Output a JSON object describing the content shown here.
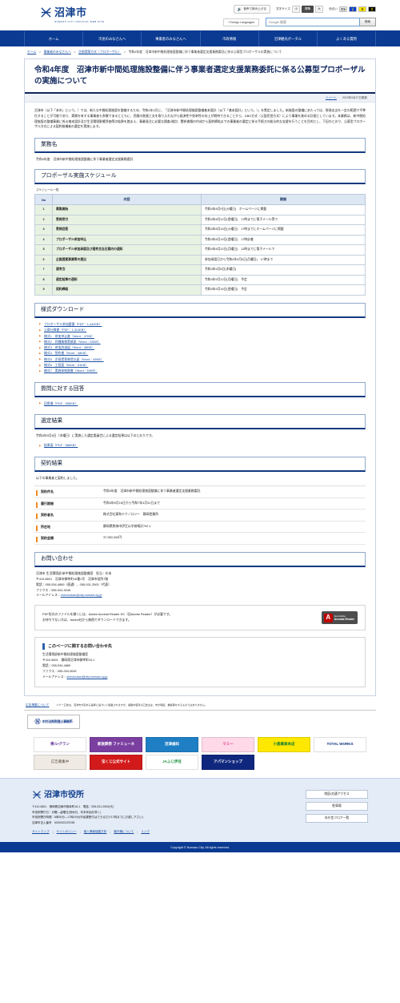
{
  "header": {
    "logo_mark": "logo-mark-icon",
    "logo_text": "沼津市",
    "logo_sub": "NUMAZU CITY OFFICIAL WEB SITE",
    "speak_label": "音声で読み上げる",
    "font_size_label": "文字サイズ",
    "font_sizes": [
      "小",
      "標準",
      "大"
    ],
    "font_size_selected": "標準",
    "color_label": "色合い",
    "color_options": [
      "標準",
      "青",
      "黄",
      "黒"
    ],
    "foreign_languages": "Foreign Languages",
    "search_placeholder": "Google 検索",
    "search_button": "検索"
  },
  "nav": {
    "items": [
      "ホーム",
      "市民のみなさんへ",
      "事業者のみなさんへ",
      "市政情報",
      "沼津観光ポータル",
      "よくある質問"
    ]
  },
  "breadcrumb": {
    "items": [
      "ホーム",
      "事業者のみなさんへ",
      "企画提案方式（プロポーザル）"
    ],
    "current": "令和4年度　沼津市新中間処理施設整備に伴う事業者選定支援業務委託に係る公募型プロポーザルの実施について"
  },
  "page": {
    "title": "令和4年度　沼津市新中間処理施設整備に伴う事業者選定支援業務委託に係る公募型プロポーザルの実施について",
    "tweet_label": "ツイート",
    "updated": "2022年9月27日更新",
    "intro": "沼津市（以下「本市」という。）では、新たな中間処理施設を整備するため、令和4年3月に、「沼津市新中間処理施設整備基本設計（以下「基本設計」という。）」を策定しました。新施設の整備にあたっては、財政支出を一定の範囲で平準化することが可能であり、実績を有する事業者も多数であるとともに、民間の創意工夫を取り入れながら経済性や効率性の向上が期待できることから、DBO方式（公設民営方式）により事業を進める計画としています。本業務は、新中間処理施設の整備事業に係る基本設計及び生活環境影響評価等の結果を踏まえ、事業発注に必要な調査・検討、関係書類の作成から契約締結までの事業者の選定に係る手続きの総合的な支援を行うことを目的とし、下記のとおり、公募型プロポーザル方式による契約候補者の選定を実施します。"
  },
  "sections": {
    "gyomumei_head": "業務名",
    "gyomumei_value": "令和4年度　沼津市新中間処理施設整備に伴う事業者選定支援業務委託",
    "schedule_head": "プロポーザル実施スケジュール",
    "schedule_caption": "スケジュール一覧",
    "forms_head": "様式ダウンロード",
    "qa_head": "質問に対する回答",
    "selection_head": "選定結果",
    "selection_note": "令和4年9月8日（木曜日）に実施した選定委員会による選定結果は以下のとおりです。",
    "contract_head": "契約結果",
    "contract_note": "以下の事業者と契約しました。",
    "contact_head": "お問い合わせ"
  },
  "schedule": {
    "columns": [
      "No",
      "内容",
      "期間"
    ],
    "rows": [
      {
        "no": "1",
        "content": "募集開始",
        "period": "令和4年8月9日(火曜日)　ホームページに掲載"
      },
      {
        "no": "2",
        "content": "質問受付",
        "period": "令和4年8月12日(金曜日)　17時までに電子メール等で"
      },
      {
        "no": "3",
        "content": "質問回答",
        "period": "令和4年8月16日(火曜日)　17時までにホームページに掲載"
      },
      {
        "no": "4",
        "content": "プロポーザル参加申込",
        "period": "令和4年8月19日(金曜日)　17時必着"
      },
      {
        "no": "5",
        "content": "プロポーザル参加承認及び選考会当日案内の通知",
        "period": "令和4年8月22日(月曜日)　12時までに電子メールで"
      },
      {
        "no": "6",
        "content": "企画提案事業等の提出",
        "period": "参加承認日から令和4年9月5日(月曜日)　17時まで"
      },
      {
        "no": "7",
        "content": "選考会",
        "period": "令和4年9月8日(木曜日)"
      },
      {
        "no": "8",
        "content": "選定結果の通知",
        "period": "令和4年9月12日(月曜日)　予定"
      },
      {
        "no": "9",
        "content": "契約締結",
        "period": "令和4年9月16日(金曜日)　予定"
      }
    ]
  },
  "form_downloads": [
    "プロポーザル参加要領（PDF：1,442KB）",
    "公募仕様書（PDF：1,314KB）",
    "様式1　参加申込書（Word：47KB）",
    "様式2　同種業務実績表（Word：53KB）",
    "様式3　参加辞退届（Word：46KB）",
    "様式4　誓約書（Word：48KB）",
    "様式5　企画提案書提出届（Word：46KB）",
    "様式6　工程表（Word：51KB）",
    "様式7　実施体制調書（Word：53KB）"
  ],
  "qa_downloads": [
    "回答書（PDF：556KB）"
  ],
  "selection_downloads": [
    "結果表（PDF：588KB）"
  ],
  "contract_result": [
    {
      "key": "契約件名",
      "value": "令和4年度　沼津市新中間処理施設整備に伴う事業者選定支援業務委託"
    },
    {
      "key": "履行期間",
      "value": "令和4年9月16日から令和7年3月31日まで"
    },
    {
      "key": "契約者名",
      "value": "株式会社東和テクノロジー　静岡営業所"
    },
    {
      "key": "所在地",
      "value": "静岡県熱海市伊豆山字前鳴沢792-1"
    },
    {
      "key": "契約金額",
      "value": "37,950,000円"
    }
  ],
  "contact": {
    "lines": [
      "沼津市 生活環境部 新中間処理施設整備室　担当：杉本",
      "〒410-8601　沼津市御幸町16番1号　沼津市役所7階",
      "電話：055-934-4889（直通）、055-931-2500（代表）",
      "ファクス：055-934-3045"
    ],
    "mail_label": "メールアドレス：",
    "mail": "shinchukan@city.numazu.lg.jp"
  },
  "pdf_notice": {
    "line1": "PDF形式のファイルを開くには、Adobe Acrobat Reader DC（旧Adobe Reader）が必要です。",
    "line2": "お持ちでない方は、Adobe社から無償でダウンロードできます。",
    "badge_small": "Get Adobe",
    "badge_big": "Acrobat Reader",
    "badge_icon": "adobe-pdf-icon"
  },
  "page_inquiry": {
    "title": "このページに関するお問い合わせ先",
    "lines": [
      "生活環境部新中間処理施設整備室",
      "〒410-8601　静岡県沼津市御幸町16-1",
      "電話：055-934-4889",
      "ファクス：055-934-3045"
    ],
    "mail_label": "メールアドレス：",
    "mail": "shinchukan@city.numazu.lg.jp"
  },
  "ads": {
    "note_link": "広告掲載について",
    "note_text": "バナー広告は、沼津市が定める基準に基づいて掲載されますが、掲載内容及び広告主は、市が保証、推奨等をするものではありません。",
    "solo_mark": "bank-logo-icon",
    "solo_label": "木村治男税理士事務所",
    "banners": [
      {
        "label": "帰ル・グラン",
        "style": "ad-a"
      },
      {
        "label": "家族葬祭 ファミューネ",
        "style": "ad-b"
      },
      {
        "label": "沼津歯科",
        "style": "ad-c"
      },
      {
        "label": "マミー",
        "style": "ad-d"
      },
      {
        "label": "小島薬局本店",
        "style": "ad-e"
      },
      {
        "label": "TOTAL WORKS",
        "style": "ad-f"
      },
      {
        "label": "広告募集中",
        "style": "ad-g"
      },
      {
        "label": "宝くじ公式サイト",
        "style": "ad-h"
      },
      {
        "label": "JAふじ伊豆",
        "style": "ad-i"
      },
      {
        "label": "アパマンショップ",
        "style": "ad-j"
      }
    ]
  },
  "footer": {
    "logo_mark": "logo-mark-icon",
    "logo_text": "沼津市役所",
    "lines": [
      "〒410-8601　静岡県沼津市御幸町16-1　電話：055-931-2500(代)",
      "市役所開庁日：月曜―金曜日(祝休日、年末年始を除く)",
      "市役所開庁時間：8時30分―17時15分(市民課受付はできるだけ17時までにお越し下さい)",
      "沼津市法人番号　6000020222038"
    ],
    "links": [
      "サイトマップ",
      "サイトポリシー",
      "個人情報保護方針",
      "著作権について",
      "リンク"
    ],
    "buttons": [
      "地図・交通アクセス",
      "駐車場",
      "市庁舎フロア一覧"
    ],
    "copyright": "Copyright © Numazu City. All rights reserved."
  }
}
